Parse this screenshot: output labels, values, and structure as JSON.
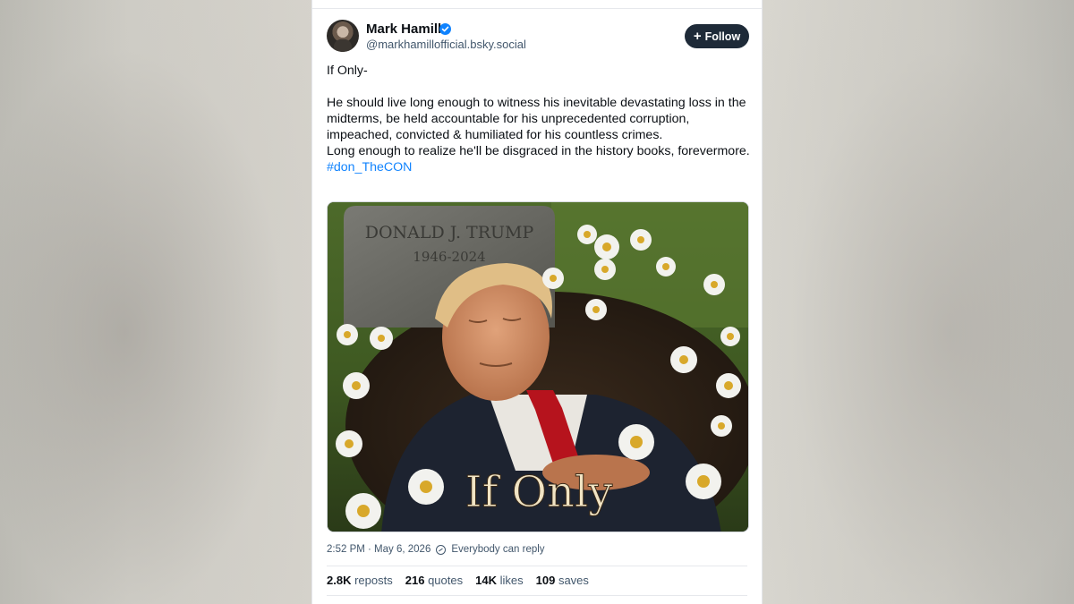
{
  "post": {
    "author_name": "Mark Hamill",
    "handle": "@markhamillofficial.bsky.social",
    "follow_label": "Follow",
    "text_line1": "If Only-",
    "text_body": "He should live long enough to witness his inevitable devastating loss in the midterms, be held accountable for his unprecedented corruption, impeached, convicted & humiliated for his countless crimes.\nLong enough to realize he'll be disgraced in the history books, forevermore.",
    "hashtag": "#don_TheCON",
    "image": {
      "headstone_name": "DONALD J. TRUMP",
      "headstone_years": "1946-2024",
      "caption": "If Only"
    },
    "timestamp": "2:52 PM · May 6, 2026",
    "reply_setting": "Everybody can reply",
    "stats": {
      "reposts_count": "2.8K",
      "reposts_label": "reposts",
      "quotes_count": "216",
      "quotes_label": "quotes",
      "likes_count": "14K",
      "likes_label": "likes",
      "saves_count": "109",
      "saves_label": "saves"
    }
  },
  "colors": {
    "accent": "#1083fe",
    "follow_bg": "#1e2a38",
    "text": "#0b0f14",
    "muted": "#42576c"
  }
}
